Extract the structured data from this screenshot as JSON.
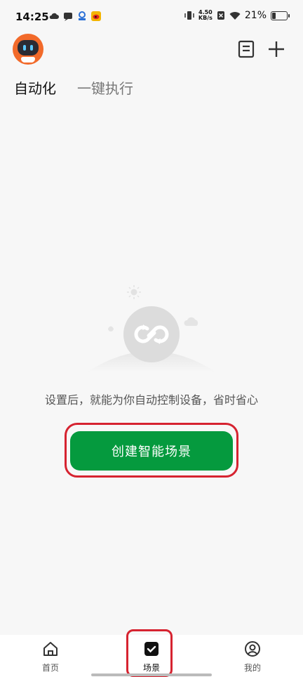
{
  "status_bar": {
    "time": "14:25",
    "net_speed_value": "4.50",
    "net_speed_unit": "KB/s",
    "battery_text": "21%",
    "battery_level": 0.21
  },
  "header": {
    "tabs": [
      {
        "label": "自动化",
        "active": true
      },
      {
        "label": "一键执行",
        "active": false
      }
    ]
  },
  "empty_state": {
    "message": "设置后，就能为你自动控制设备，省时省心",
    "cta_label": "创建智能场景"
  },
  "bottom_nav": {
    "items": [
      {
        "label": "首页",
        "icon": "home-icon"
      },
      {
        "label": "场景",
        "icon": "scene-check-icon",
        "active": true
      },
      {
        "label": "我的",
        "icon": "profile-icon"
      }
    ]
  },
  "colors": {
    "accent_green": "#059a3e",
    "highlight_red": "#d62330",
    "avatar_orange": "#f26a2a"
  }
}
